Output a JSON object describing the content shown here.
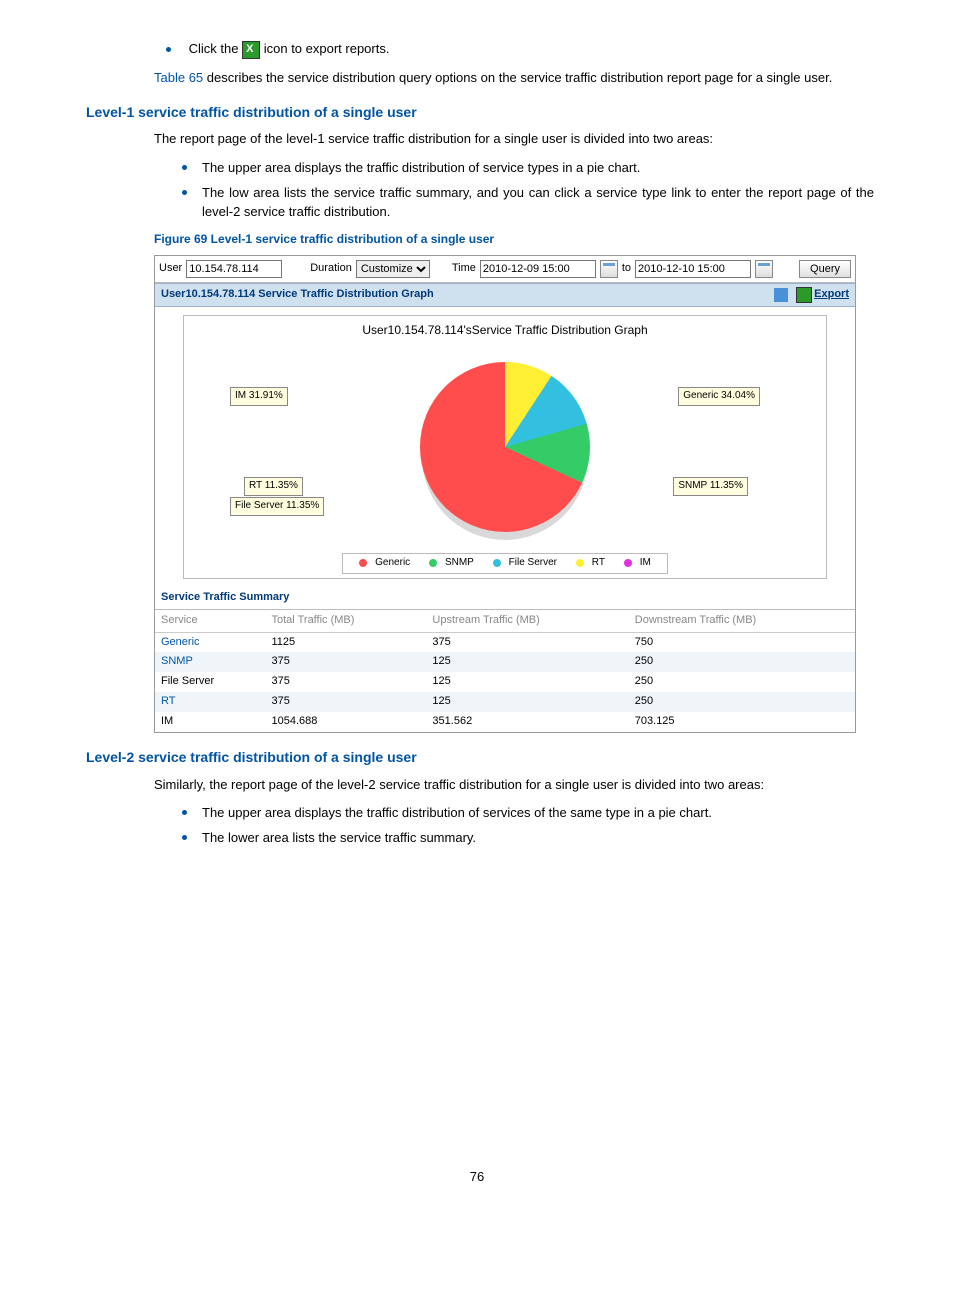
{
  "intro": {
    "click_the": "Click the",
    "to_export": " icon to export reports.",
    "table_link": "Table 65",
    "table_link_after": " describes the service distribution query options on the service traffic distribution report page for a single user."
  },
  "level1": {
    "heading": "Level-1 service traffic distribution of a single user",
    "para": "The report page of the level-1 service traffic distribution for a single user is divided into two areas:",
    "b1": "The upper area displays the traffic distribution of service types in a pie chart.",
    "b2": "The low area lists the service traffic summary, and you can click a service type link to enter the report page of the level-2 service traffic distribution.",
    "fig": "Figure 69 Level-1 service traffic distribution of a single user"
  },
  "shot": {
    "user_label": "User",
    "user_value": "10.154.78.114",
    "duration_label": "Duration",
    "duration_value": "Customize",
    "time_label": "Time",
    "time_from": "2010-12-09 15:00",
    "to_label": "to",
    "time_to": "2010-12-10 15:00",
    "query_label": "Query",
    "bar_title": "User10.154.78.114 Service Traffic Distribution Graph",
    "export_label": "Export",
    "chart_title": "User10.154.78.114'sService Traffic Distribution Graph",
    "callouts": {
      "im": "IM    31.91%",
      "rt": "RT  11.35%",
      "fs": "File Server 11.35%",
      "generic": "Generic 34.04%",
      "snmp": "SNMP  11.35%"
    },
    "legend": {
      "generic": "Generic",
      "snmp": "SNMP",
      "fs": "File Server",
      "rt": "RT",
      "im": "IM"
    },
    "summary_title": "Service Traffic Summary",
    "columns": {
      "c1": "Service",
      "c2": "Total Traffic (MB)",
      "c3": "Upstream Traffic (MB)",
      "c4": "Downstream Traffic (MB)"
    },
    "rows": [
      {
        "service": "Generic",
        "link": true,
        "total": "1125",
        "up": "375",
        "down": "750"
      },
      {
        "service": "SNMP",
        "link": true,
        "total": "375",
        "up": "125",
        "down": "250"
      },
      {
        "service": "File Server",
        "link": false,
        "total": "375",
        "up": "125",
        "down": "250"
      },
      {
        "service": "RT",
        "link": true,
        "total": "375",
        "up": "125",
        "down": "250"
      },
      {
        "service": "IM",
        "link": false,
        "total": "1054.688",
        "up": "351.562",
        "down": "703.125"
      }
    ]
  },
  "level2": {
    "heading": "Level-2 service traffic distribution of a single user",
    "para": "Similarly, the report page of the level-2 service traffic distribution for a single user is divided into two areas:",
    "b1": "The upper area displays the traffic distribution of services of the same type in a pie chart.",
    "b2": "The lower area lists the service traffic summary."
  },
  "chart_data": {
    "type": "pie",
    "title": "User10.154.78.114'sService Traffic Distribution Graph",
    "series": [
      {
        "name": "Generic",
        "value": 34.04,
        "color": "#ff4d4d"
      },
      {
        "name": "SNMP",
        "value": 11.35,
        "color": "#33cc66"
      },
      {
        "name": "File Server",
        "value": 11.35,
        "color": "#33bfe0"
      },
      {
        "name": "RT",
        "value": 11.35,
        "color": "#ffee33"
      },
      {
        "name": "IM",
        "value": 31.91,
        "color": "#e033e0"
      }
    ]
  },
  "page_number": "76"
}
